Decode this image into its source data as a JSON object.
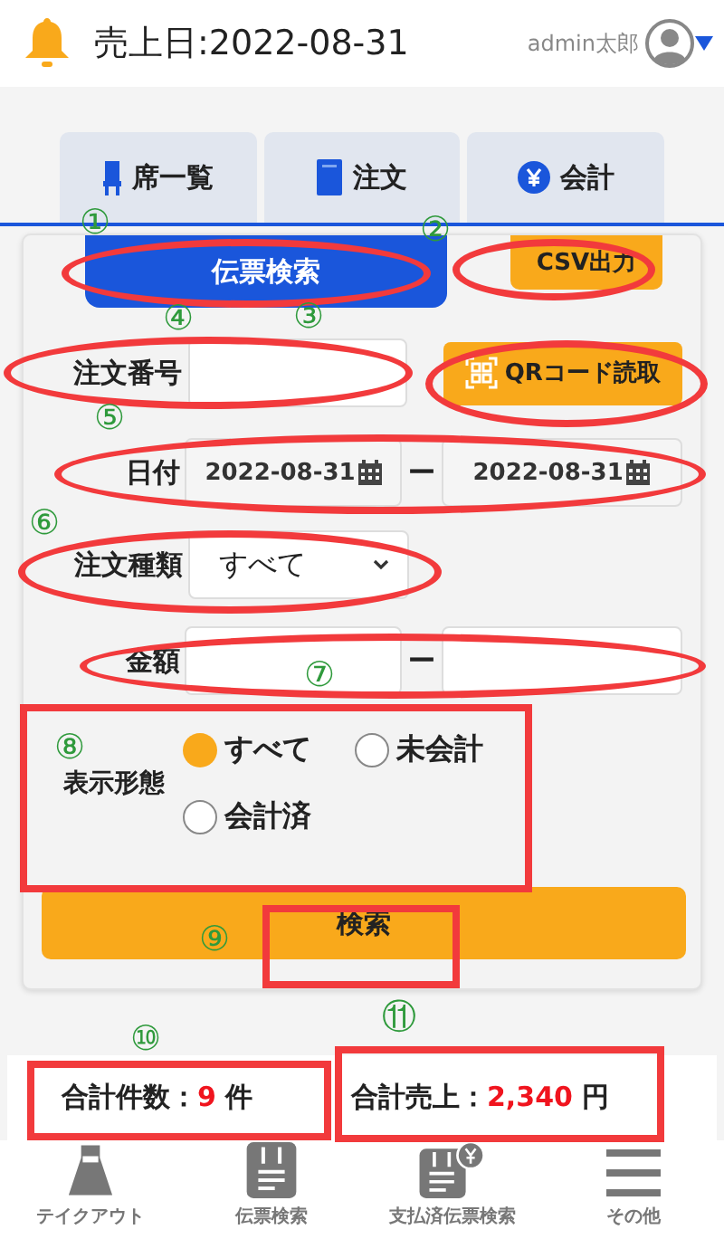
{
  "header": {
    "sales_date": "売上日:2022-08-31",
    "user": "admin太郎"
  },
  "tabs": [
    {
      "label": "席一覧",
      "kind": "chair"
    },
    {
      "label": "注文",
      "kind": "book"
    },
    {
      "label": "会計",
      "kind": "yen"
    }
  ],
  "search_panel": {
    "mode_button": "伝票検索",
    "csv_button": "CSV出力",
    "order_number": {
      "label": "注文番号"
    },
    "qr_button": "QRコード読取",
    "date": {
      "label": "日付",
      "from": "2022-08-31",
      "to": "2022-08-31",
      "separator": "ー"
    },
    "order_type": {
      "label": "注文種類",
      "value": "すべて"
    },
    "amount": {
      "label": "金額",
      "separator": "ー"
    },
    "display_mode": {
      "label": "表示形態",
      "options": [
        {
          "label": "すべて",
          "selected": true
        },
        {
          "label": "未会計",
          "selected": false
        },
        {
          "label": "会計済",
          "selected": false
        }
      ]
    },
    "search_button": "検索"
  },
  "summary": {
    "count_label": "合計件数：",
    "count": "9",
    "count_unit": "件",
    "sales_label": "合計売上：",
    "sales": "2,340",
    "sales_unit": "円"
  },
  "bottom_nav": [
    {
      "label": "テイクアウト",
      "kind": "bag"
    },
    {
      "label": "伝票検索",
      "kind": "receipt"
    },
    {
      "label": "支払済伝票検索",
      "kind": "receipt-paid"
    },
    {
      "label": "その他",
      "kind": "menu"
    }
  ],
  "annotations": [
    {
      "number": "①",
      "kind": "ellipse"
    },
    {
      "number": "②",
      "kind": "ellipse"
    },
    {
      "number": "③",
      "kind": "ellipse"
    },
    {
      "number": "④",
      "kind": "ellipse"
    },
    {
      "number": "⑤",
      "kind": "ellipse"
    },
    {
      "number": "⑥",
      "kind": "ellipse"
    },
    {
      "number": "⑦",
      "kind": "ellipse"
    },
    {
      "number": "⑧",
      "kind": "rect"
    },
    {
      "number": "⑨",
      "kind": "rect"
    },
    {
      "number": "⑩",
      "kind": "rect"
    },
    {
      "number": "⑪",
      "kind": "rect"
    }
  ]
}
